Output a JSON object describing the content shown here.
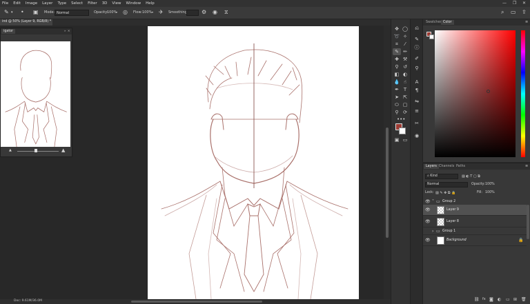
{
  "menu": [
    "File",
    "Edit",
    "Image",
    "Layer",
    "Type",
    "Select",
    "Filter",
    "3D",
    "View",
    "Window",
    "Help"
  ],
  "window_controls": [
    "—",
    "❐",
    "✕"
  ],
  "options_bar": {
    "mode_label": "Mode:",
    "mode_value": "Normal",
    "opacity_label": "Opacity:",
    "opacity_value": "100%",
    "flow_label": "Flow:",
    "flow_value": "100%",
    "smoothing_label": "Smoothing:",
    "smoothing_value": "",
    "search_icon": "search-icon",
    "layout_icon": "workspace-icon",
    "share_icon": "share-icon"
  },
  "document_tab": {
    "title": "ind @ 50% (Layer 9, RGB/8) *",
    "close": "✕"
  },
  "navigator": {
    "tab_label": "igator",
    "close": "✕"
  },
  "status": {
    "doc_info": "Doc: 9.61M/36.0M"
  },
  "color_panel": {
    "tabs": [
      "Swatches",
      "Color"
    ],
    "active_tab": "Color",
    "foreground": "#9e3b33",
    "background": "#ffffff"
  },
  "layers_panel": {
    "tabs": [
      "Layers",
      "Channels",
      "Paths"
    ],
    "active_tab": "Layers",
    "filter_label": "Kind",
    "blend_mode": "Normal",
    "opacity_label": "Opacity:",
    "opacity_value": "100%",
    "lock_label": "Lock:",
    "fill_label": "Fill:",
    "fill_value": "100%",
    "layers": [
      {
        "name": "Group 2",
        "type": "group",
        "visible": true,
        "selected": false
      },
      {
        "name": "Layer 9",
        "type": "layer",
        "visible": true,
        "selected": true
      },
      {
        "name": "Layer 8",
        "type": "layer",
        "visible": true,
        "selected": false
      },
      {
        "name": "Group 1",
        "type": "group",
        "visible": false,
        "selected": false
      },
      {
        "name": "Background",
        "type": "background",
        "visible": true,
        "selected": false
      }
    ]
  },
  "colors": {
    "sketch_stroke": "#a9706a",
    "guide_line": "#8a5550"
  }
}
